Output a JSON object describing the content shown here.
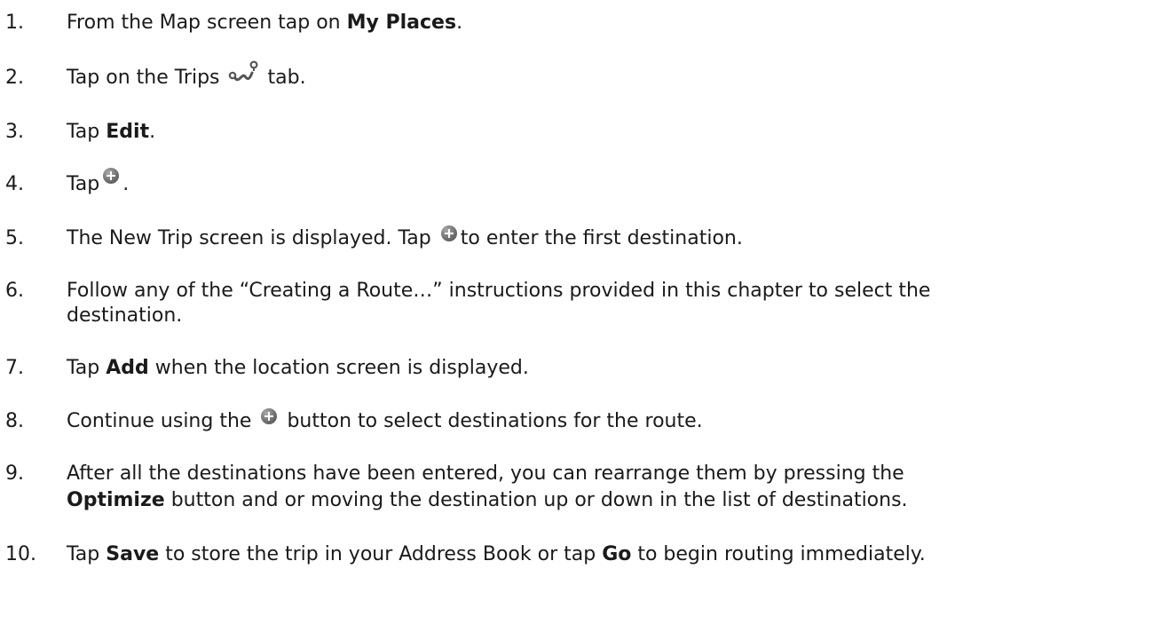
{
  "steps": [
    {
      "num": "1.",
      "a": "From the Map screen tap on ",
      "b": "My Places",
      "c": "."
    },
    {
      "num": "2.",
      "a": "Tap on the Trips",
      "icon": "trips-route-icon",
      "b": "tab."
    },
    {
      "num": "3.",
      "a": "Tap ",
      "b": "Edit",
      "c": "."
    },
    {
      "num": "4.",
      "a": "Tap",
      "icon": "add-circle-icon",
      "b": "."
    },
    {
      "num": "5.",
      "a": "The New Trip screen is displayed.  Tap",
      "icon": "add-circle-icon",
      "b": "to enter the first destination."
    },
    {
      "num": "6.",
      "a": "Follow any of the “Creating a Route…” instructions provided in this chapter to select the",
      "b": "destination."
    },
    {
      "num": "7.",
      "a": "Tap ",
      "b": "Add",
      "c": " when the location screen is displayed."
    },
    {
      "num": "8.",
      "a": "Continue using the",
      "icon": "add-circle-icon",
      "b": "button to select destinations for the route."
    },
    {
      "num": "9.",
      "a": "After all the destinations have been entered, you can rearrange them by pressing the",
      "b": "Optimize",
      "c": " button and or moving the destination up or down in the list of destinations."
    },
    {
      "num": "10.",
      "a": "Tap ",
      "b": "Save",
      "c": " to store the trip in your Address Book or tap ",
      "d": "Go",
      "e": " to begin routing immediately."
    }
  ]
}
